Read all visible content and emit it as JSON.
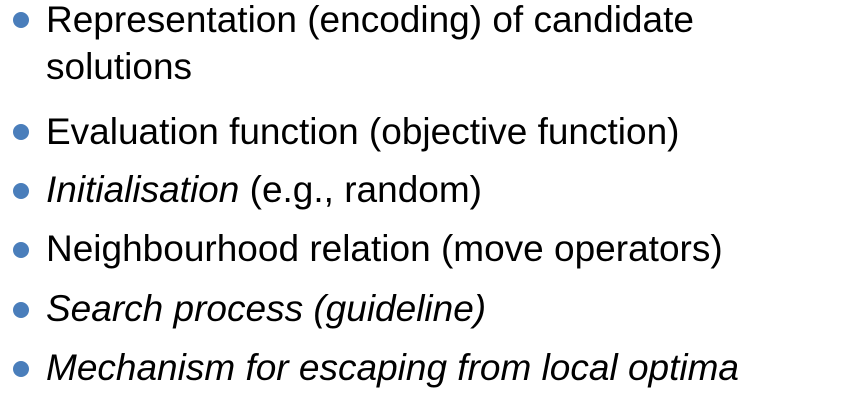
{
  "bullets": [
    {
      "line1": "Representation (encoding) of candidate",
      "line2": "solutions"
    },
    {
      "text": "Evaluation function (objective function)"
    },
    {
      "italic": "Initialisation",
      "rest": " (e.g., random)"
    },
    {
      "text": "Neighbourhood relation (move operators)"
    },
    {
      "text": "Search process (guideline)"
    },
    {
      "text": "Mechanism for escaping from local optima"
    }
  ],
  "colors": {
    "bullet": "#4a7ebb",
    "text": "#000000",
    "background": "#ffffff"
  },
  "icons": {
    "bullet": "bullet-dot-icon"
  }
}
